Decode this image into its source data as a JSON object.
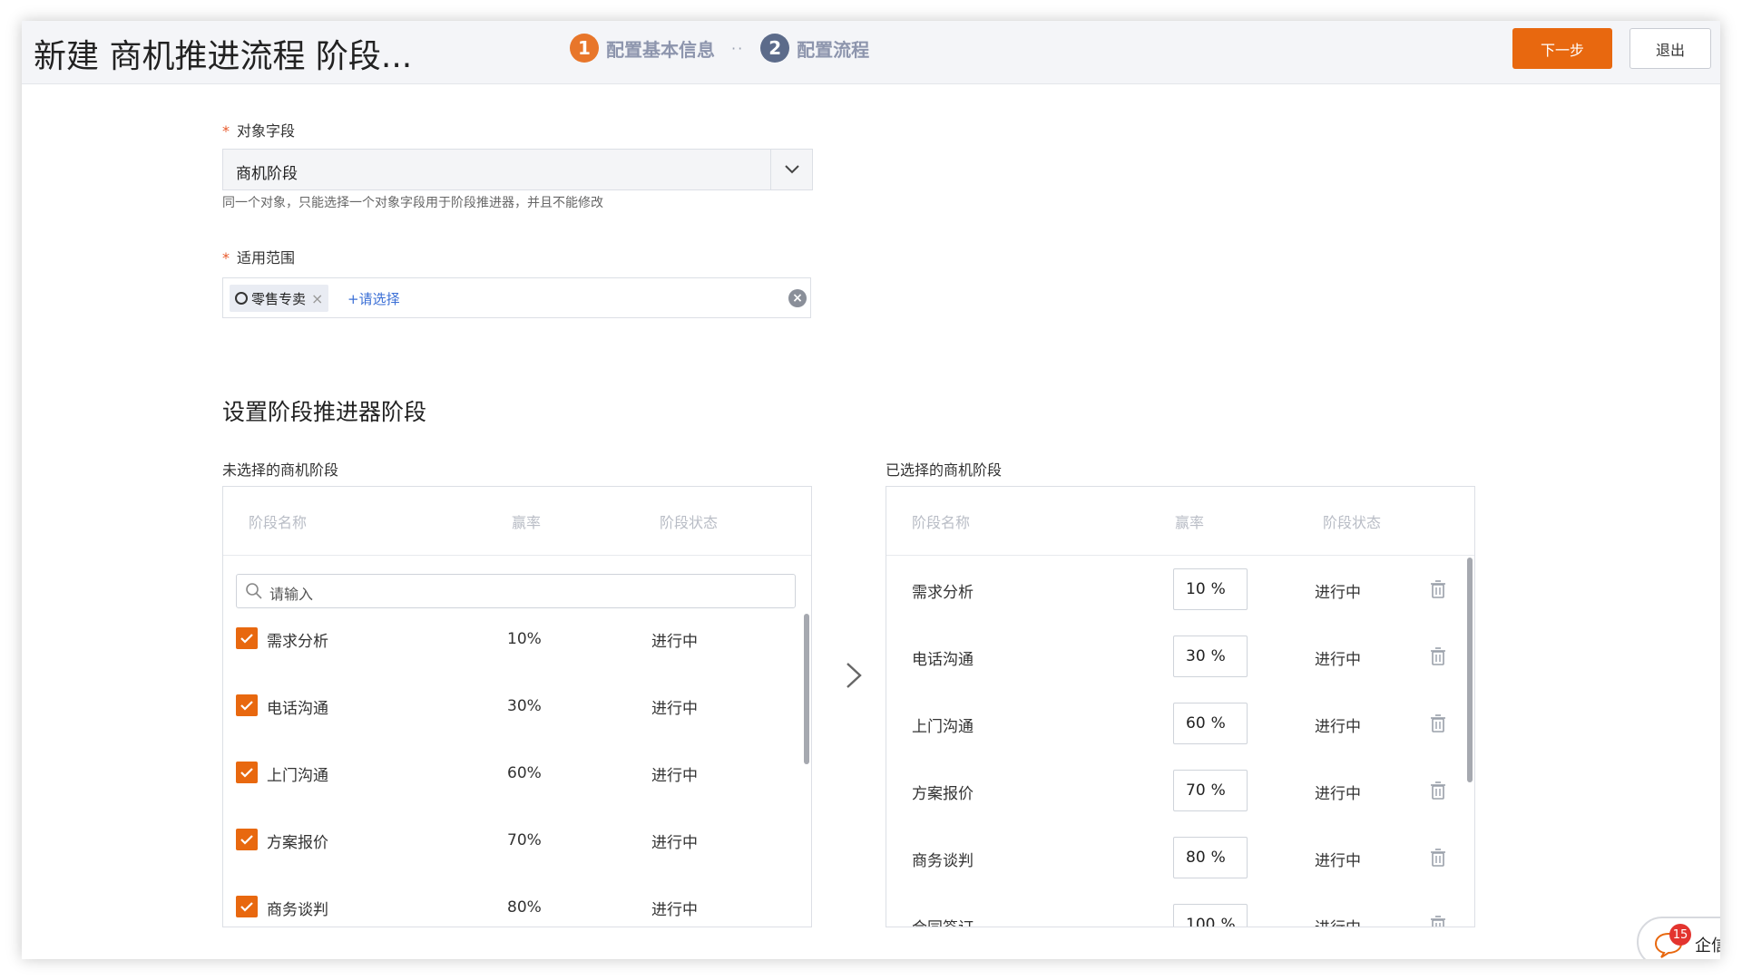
{
  "header": {
    "title": "新建 商机推进流程 阶段...",
    "steps": [
      {
        "num": "1",
        "label": "配置基本信息"
      },
      {
        "num": "2",
        "label": "配置流程"
      }
    ],
    "step_separator": "··",
    "next_button": "下一步",
    "exit_button": "退出"
  },
  "form": {
    "object_field": {
      "required_mark": "*",
      "label": "对象字段",
      "value": "商机阶段",
      "hint": "同一个对象，只能选择一个对象字段用于阶段推进器，并且不能修改"
    },
    "scope": {
      "required_mark": "*",
      "label": "适用范围",
      "tag": "零售专卖",
      "tag_remove": "×",
      "add_link": "+请选择",
      "clear": "×"
    }
  },
  "section": {
    "title": "设置阶段推进器阶段"
  },
  "unselected": {
    "label": "未选择的商机阶段",
    "columns": [
      "阶段名称",
      "赢率",
      "阶段状态"
    ],
    "search_placeholder": "请输入",
    "rows": [
      {
        "name": "需求分析",
        "rate": "10%",
        "status": "进行中",
        "checked": true
      },
      {
        "name": "电话沟通",
        "rate": "30%",
        "status": "进行中",
        "checked": true
      },
      {
        "name": "上门沟通",
        "rate": "60%",
        "status": "进行中",
        "checked": true
      },
      {
        "name": "方案报价",
        "rate": "70%",
        "status": "进行中",
        "checked": true
      },
      {
        "name": "商务谈判",
        "rate": "80%",
        "status": "进行中",
        "checked": true
      }
    ]
  },
  "selected": {
    "label": "已选择的商机阶段",
    "columns": [
      "阶段名称",
      "赢率",
      "阶段状态"
    ],
    "rows": [
      {
        "name": "需求分析",
        "rate": "10",
        "unit": "%",
        "status": "进行中"
      },
      {
        "name": "电话沟通",
        "rate": "30",
        "unit": "%",
        "status": "进行中"
      },
      {
        "name": "上门沟通",
        "rate": "60",
        "unit": "%",
        "status": "进行中"
      },
      {
        "name": "方案报价",
        "rate": "70",
        "unit": "%",
        "status": "进行中"
      },
      {
        "name": "商务谈判",
        "rate": "80",
        "unit": "%",
        "status": "进行中"
      },
      {
        "name": "合同签订",
        "rate": "100",
        "unit": "%",
        "status": "进行中"
      }
    ]
  },
  "chat_widget": {
    "badge": "15",
    "label": "企信"
  },
  "colors": {
    "accent": "#e8680f",
    "step_inactive": "#5c6b8a",
    "link": "#3b6fd6"
  }
}
